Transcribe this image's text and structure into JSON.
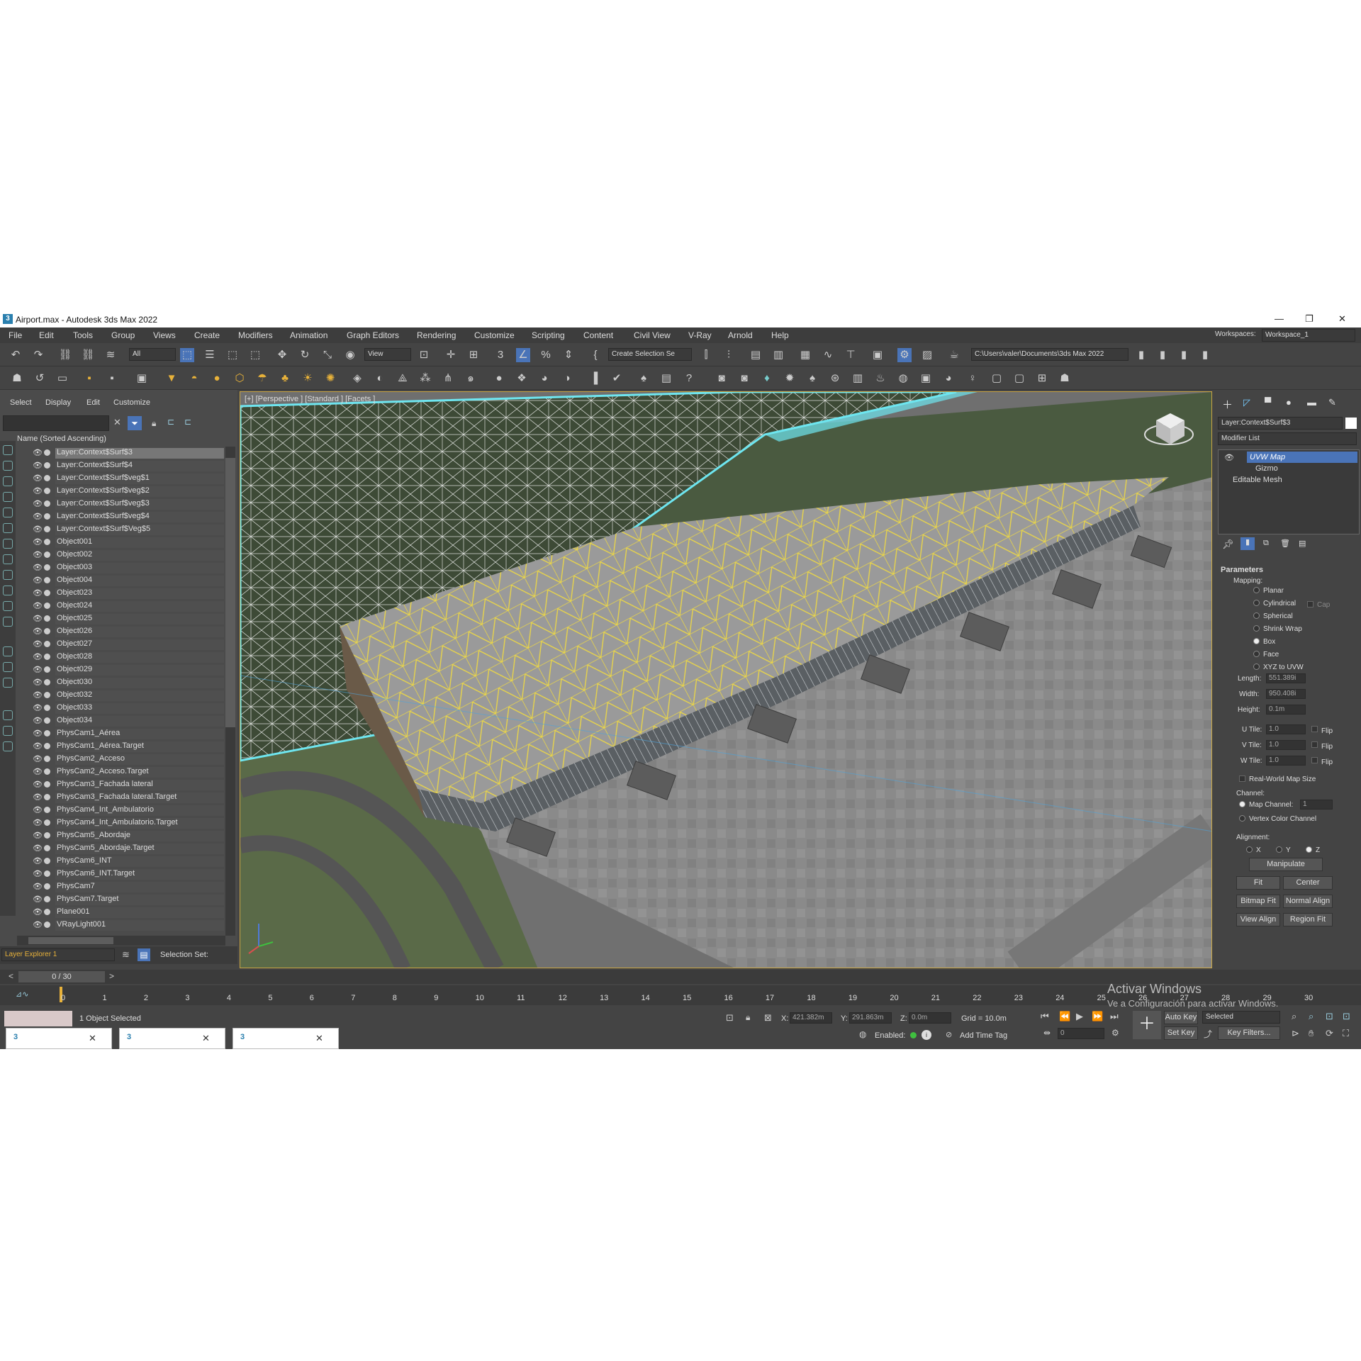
{
  "window": {
    "title": "Airport.max - Autodesk 3ds Max 2022",
    "min": "—",
    "max": "❐",
    "close": "✕"
  },
  "menu": [
    "File",
    "Edit",
    "Tools",
    "Group",
    "Views",
    "Create",
    "Modifiers",
    "Animation",
    "Graph Editors",
    "Rendering",
    "Customize",
    "Scripting",
    "Content",
    "Civil View",
    "V-Ray",
    "Arnold",
    "Help"
  ],
  "workspace": {
    "label": "Workspaces:",
    "value": "Workspace_1"
  },
  "toolbar": {
    "filter": "All",
    "refcoord": "View",
    "selection_set": "Create Selection Se",
    "project_path": "C:\\Users\\valer\\Documents\\3ds Max 2022"
  },
  "scene_explorer": {
    "menus": [
      "Select",
      "Display",
      "Edit",
      "Customize"
    ],
    "column_header": "Name (Sorted Ascending)",
    "items": [
      "Layer:Context$Surf$3",
      "Layer:Context$Surf$4",
      "Layer:Context$Surf$veg$1",
      "Layer:Context$Surf$veg$2",
      "Layer:Context$Surf$veg$3",
      "Layer:Context$Surf$veg$4",
      "Layer:Context$Surf$Veg$5",
      "Object001",
      "Object002",
      "Object003",
      "Object004",
      "Object023",
      "Object024",
      "Object025",
      "Object026",
      "Object027",
      "Object028",
      "Object029",
      "Object030",
      "Object032",
      "Object033",
      "Object034",
      "PhysCam1_Aérea",
      "PhysCam1_Aérea.Target",
      "PhysCam2_Acceso",
      "PhysCam2_Acceso.Target",
      "PhysCam3_Fachada lateral",
      "PhysCam3_Fachada lateral.Target",
      "PhysCam4_Int_Ambulatorio",
      "PhysCam4_Int_Ambulatorio.Target",
      "PhysCam5_Abordaje",
      "PhysCam5_Abordaje.Target",
      "PhysCam6_INT",
      "PhysCam6_INT.Target",
      "PhysCam7",
      "PhysCam7.Target",
      "Plane001",
      "VRayLight001"
    ],
    "layer_explorer": "Layer Explorer 1",
    "selection_set_label": "Selection Set:"
  },
  "viewport": {
    "label": "[+] [Perspective ] [Standard ] [Facets ]"
  },
  "command_panel": {
    "object_name": "Layer:Context$Surf$3",
    "modifier_list": "Modifier List",
    "stack": [
      "UVW Map",
      "Gizmo",
      "Editable Mesh"
    ],
    "rollout": "Parameters",
    "mapping_label": "Mapping:",
    "mapping_options": [
      "Planar",
      "Cylindrical",
      "Spherical",
      "Shrink Wrap",
      "Box",
      "Face",
      "XYZ to UVW"
    ],
    "cap_label": "Cap",
    "length_label": "Length:",
    "length": "551.389i",
    "width_label": "Width:",
    "width": "950.408i",
    "height_label": "Height:",
    "height": "0.1m",
    "utile_label": "U Tile:",
    "utile": "1.0",
    "vtile_label": "V Tile:",
    "vtile": "1.0",
    "wtile_label": "W Tile:",
    "wtile": "1.0",
    "flip_label": "Flip",
    "realworld": "Real-World Map Size",
    "channel_label": "Channel:",
    "map_channel": "Map Channel:",
    "map_channel_value": "1",
    "vertex_color": "Vertex Color Channel",
    "alignment_label": "Alignment:",
    "axes": [
      "X",
      "Y",
      "Z"
    ],
    "buttons": [
      "Manipulate",
      "Fit",
      "Center",
      "Bitmap Fit",
      "Normal Align",
      "View Align",
      "Region Fit"
    ]
  },
  "timeline": {
    "frame": "0 / 30",
    "ticks": [
      "0",
      "1",
      "2",
      "3",
      "4",
      "5",
      "6",
      "7",
      "8",
      "9",
      "10",
      "11",
      "12",
      "13",
      "14",
      "15",
      "16",
      "17",
      "18",
      "19",
      "20",
      "21",
      "22",
      "23",
      "24",
      "25",
      "26",
      "27",
      "28",
      "29",
      "30"
    ]
  },
  "status": {
    "selected": "1 Object Selected",
    "x_label": "X:",
    "x": "421.382m",
    "y_label": "Y:",
    "y": "291.863m",
    "z_label": "Z:",
    "z": "0.0m",
    "grid": "Grid = 10.0m",
    "enabled": "Enabled:",
    "add_time_tag": "Add Time Tag",
    "autokey": "Auto Key",
    "setkey": "Set Key",
    "selected_dd": "Selected",
    "key_filters": "Key Filters...",
    "frame_field": "0"
  },
  "watermark": {
    "title": "Activar Windows",
    "sub": "Ve a Configuración para activar Windows."
  },
  "colors": {
    "selection_blue": "#4a74b8",
    "wire_yellow": "#e8d44a",
    "wire_white": "#ffffff",
    "wire_cyan": "#6ee6f0"
  }
}
